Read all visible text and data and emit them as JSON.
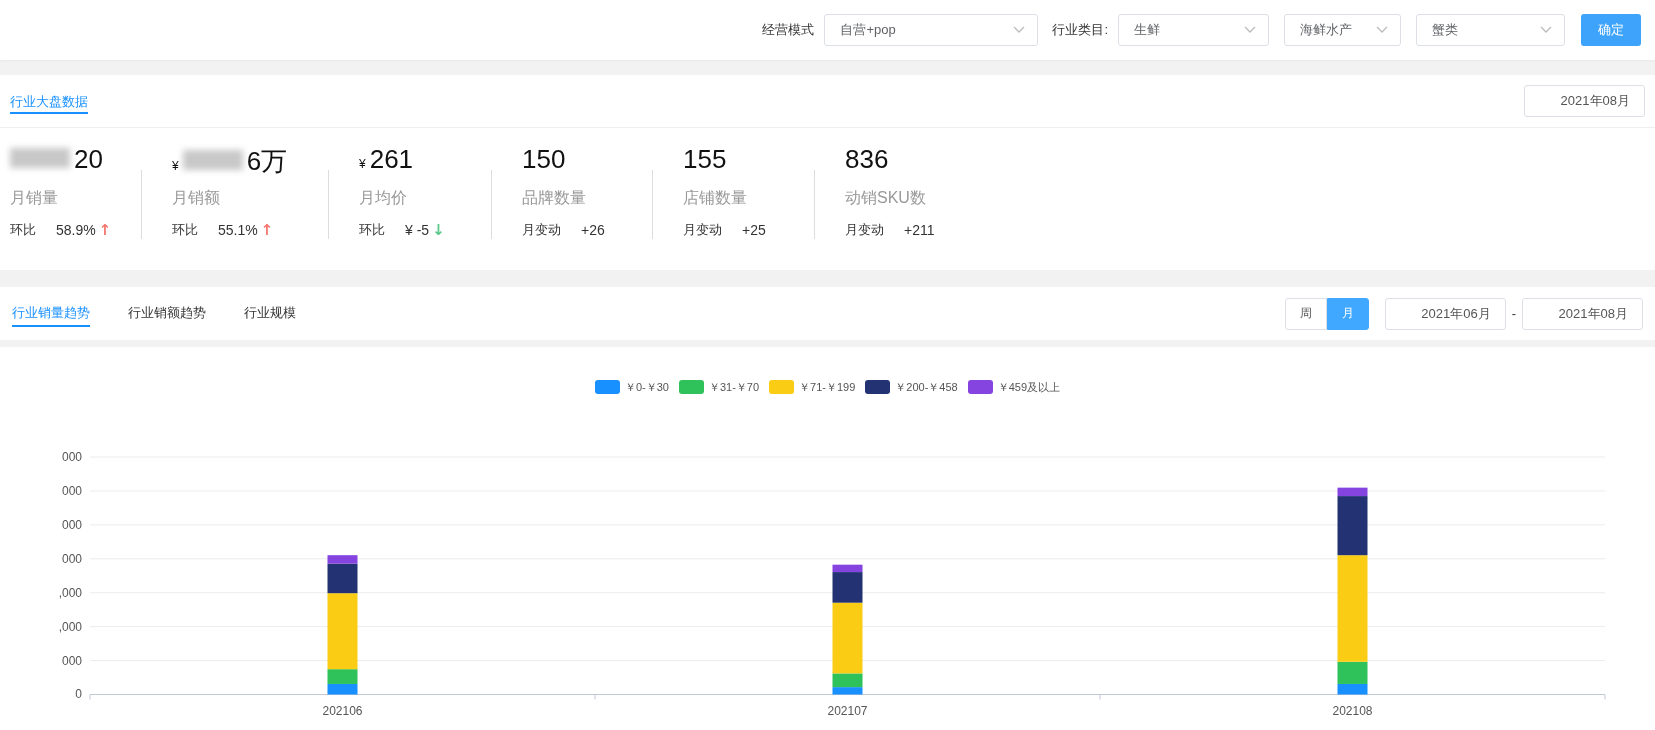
{
  "filters": {
    "mode_label": "经营模式",
    "mode": {
      "value": "自营+pop"
    },
    "category_label": "行业类目:",
    "category_levels": [
      {
        "value": "生鲜"
      },
      {
        "value": "海鲜水产"
      },
      {
        "value": "蟹类"
      }
    ],
    "confirm": "确定"
  },
  "overview": {
    "tabs": [
      {
        "label": "行业大盘数据",
        "selected": true
      }
    ],
    "month": "2021年08月",
    "stats": [
      {
        "value": "20",
        "redacted": true,
        "label": "月销量",
        "change_label": "环比",
        "change": "58.9%",
        "arrow": "↑",
        "color": "#f5766e"
      },
      {
        "prefix": "¥",
        "value": "6万",
        "redacted": true,
        "label": "月销额",
        "change_label": "环比",
        "change": "55.1%",
        "arrow": "↑",
        "color": "#f5766e"
      },
      {
        "prefix": "¥",
        "value": "261",
        "label": "月均价",
        "change_label": "环比",
        "change": "¥ -5",
        "arrow": "↓",
        "color": "#5cc98b"
      },
      {
        "value": "150",
        "label": "品牌数量",
        "change_label": "月变动",
        "change": "+26"
      },
      {
        "value": "155",
        "label": "店铺数量",
        "change_label": "月变动",
        "change": "+25"
      },
      {
        "value": "836",
        "label": "动销SKU数",
        "change_label": "月变动",
        "change": "+211"
      }
    ]
  },
  "trends": {
    "tabs": [
      {
        "label": "行业销量趋势",
        "selected": true
      },
      {
        "label": "行业销额趋势",
        "selected": false
      },
      {
        "label": "行业规模",
        "selected": false
      }
    ],
    "period": [
      {
        "label": "周",
        "selected": false
      },
      {
        "label": "月",
        "selected": true
      }
    ],
    "range_start": "2021年06月",
    "range_separator": "-",
    "range_end": "2021年08月"
  },
  "chart": {
    "legend": [
      {
        "label": "￥0-￥30",
        "color": "#1890ff"
      },
      {
        "label": "￥31-￥70",
        "color": "#2fc25b"
      },
      {
        "label": "￥71-￥199",
        "color": "#facc14"
      },
      {
        "label": "￥200-￥458",
        "color": "#223273"
      },
      {
        "label": "￥459及以上",
        "color": "#8543e0"
      }
    ],
    "y_ticks": [
      "000",
      "000",
      "000",
      "000",
      ",000",
      ",000",
      "000",
      "0"
    ],
    "x_labels": [
      "202106",
      "202107",
      "202108"
    ]
  }
}
